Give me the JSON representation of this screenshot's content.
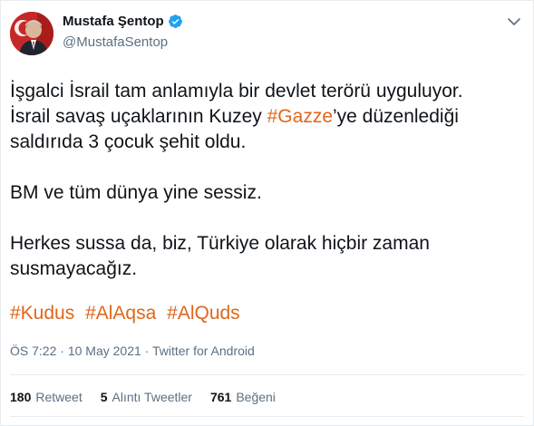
{
  "author": {
    "name": "Mustafa Şentop",
    "handle": "@MustafaSentop",
    "verified_icon": "verified-badge-icon",
    "avatar_icon": "profile-photo"
  },
  "tweet": {
    "line1": "İşgalci İsrail tam anlamıyla bir devlet terörü uyguluyor.",
    "line2_before": "İsrail savaş uçaklarının Kuzey ",
    "line2_hashtag": "#Gazze",
    "line2_after": "’ye düzenlediği",
    "line3": "saldırıda 3 çocuk şehit oldu.",
    "line4": "BM ve tüm dünya yine sessiz.",
    "line5": "Herkes sussa da, biz, Türkiye olarak hiçbir zaman",
    "line6": "susmayacağız.",
    "hashtags": [
      "#Kudus",
      "#AlAqsa",
      "#AlQuds"
    ]
  },
  "meta": {
    "time": "ÖS 7:22",
    "sep1": " · ",
    "date": "10 May 2021",
    "sep2": " · ",
    "source": "Twitter for Android"
  },
  "stats": {
    "retweets_count": "180",
    "retweets_label": "Retweet",
    "quotes_count": "5",
    "quotes_label": "Alıntı Tweetler",
    "likes_count": "761",
    "likes_label": "Beğeni"
  },
  "colors": {
    "hashtag": "#e0661b",
    "verified": "#1da1f2",
    "secondary_text": "#5b7083"
  }
}
